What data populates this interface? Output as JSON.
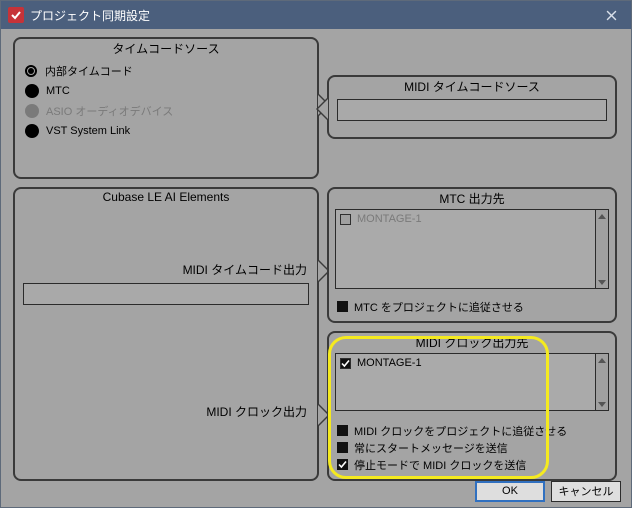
{
  "titlebar": {
    "title": "プロジェクト同期設定"
  },
  "panels": {
    "timecode_source": {
      "title": "タイムコードソース",
      "options": [
        {
          "label": "内部タイムコード",
          "state": "selected"
        },
        {
          "label": "MTC",
          "state": "filled"
        },
        {
          "label": "ASIO オーディオデバイス",
          "state": "disabled"
        },
        {
          "label": "VST System Link",
          "state": "filled"
        }
      ]
    },
    "midi_timecode_source": {
      "title": "MIDI タイムコードソース"
    },
    "cubase": {
      "title": "Cubase LE AI Elements",
      "midi_tc_out_label": "MIDI タイムコード出力",
      "midi_clock_out_label": "MIDI クロック出力"
    },
    "mtc_out": {
      "title": "MTC 出力先",
      "items": [
        {
          "label": "MONTAGE-1",
          "checked": false
        }
      ],
      "opts": [
        {
          "label": "MTC をプロジェクトに追従させる",
          "checked": false
        }
      ]
    },
    "midi_clock_out": {
      "title": "MIDI クロック出力先",
      "items": [
        {
          "label": "MONTAGE-1",
          "checked": true
        }
      ],
      "opts": [
        {
          "label": "MIDI クロックをプロジェクトに追従させる",
          "checked": false
        },
        {
          "label": "常にスタートメッセージを送信",
          "checked": false
        },
        {
          "label": "停止モードで MIDI クロックを送信",
          "checked": true
        }
      ]
    }
  },
  "footer": {
    "ok": "OK",
    "cancel": "キャンセル"
  }
}
